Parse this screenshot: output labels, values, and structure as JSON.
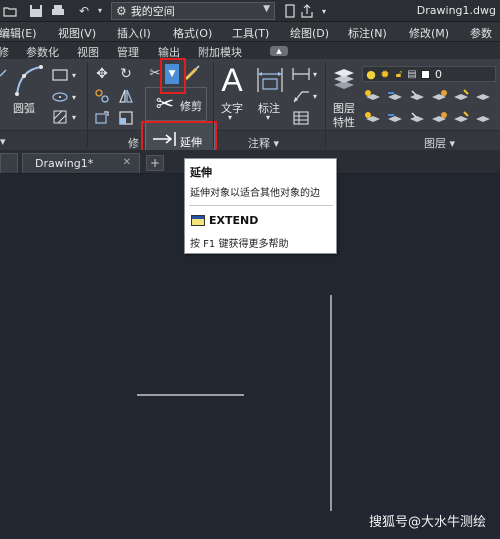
{
  "window": {
    "title": "Drawing1.dwg"
  },
  "quick_access": {
    "workspace": "我的空间",
    "icons": [
      "folder-icon",
      "save-icon",
      "undo-icon",
      "redo-icon",
      "share-icon"
    ]
  },
  "menu": {
    "items": [
      "编辑(E)",
      "视图(V)",
      "插入(I)",
      "格式(O)",
      "工具(T)",
      "绘图(D)",
      "标注(N)",
      "修改(M)",
      "参数"
    ]
  },
  "ribbon_tabs": {
    "items": [
      "修",
      "参数化",
      "视图",
      "管理",
      "输出",
      "附加模块"
    ]
  },
  "ribbon": {
    "draw": {
      "arc_label": "圆弧"
    },
    "modify": {
      "trim_label": "修剪",
      "extend_label": "延伸",
      "panel_title": "修"
    },
    "annotation": {
      "text_label": "文字",
      "dimension_label": "标注",
      "panel_title": "注释 ▾"
    },
    "layers": {
      "properties_label_1": "图层",
      "properties_label_2": "特性",
      "current_layer": "0",
      "panel_title": "图层 ▾"
    }
  },
  "document_tabs": {
    "active": "Drawing1*",
    "close": "✕",
    "new": "+"
  },
  "tooltip": {
    "title": "延伸",
    "description": "延伸对象以适合其他对象的边",
    "command": "EXTEND",
    "help": "按 F1 键获得更多帮助"
  },
  "watermark": "搜狐号@大水牛测绘",
  "colors": {
    "highlight": "#e02020",
    "canvas": "#212630"
  }
}
